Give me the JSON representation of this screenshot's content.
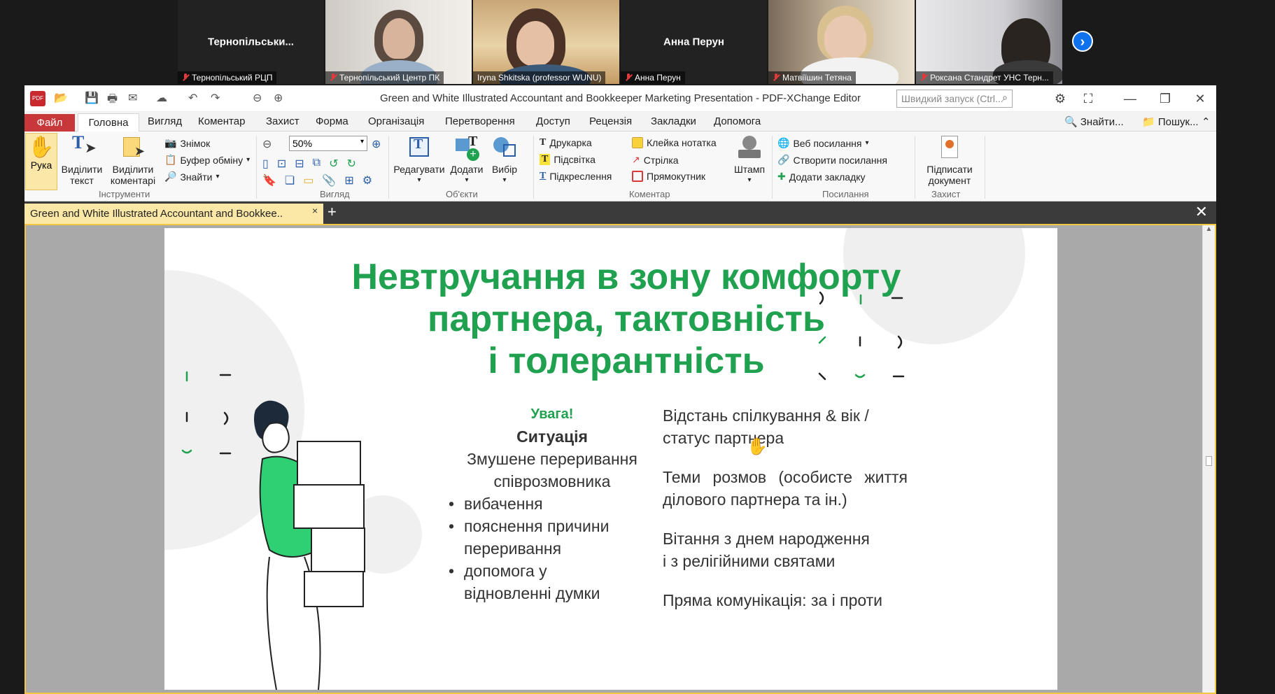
{
  "zoom_call": {
    "participants": [
      {
        "center_name": "Тернопільськи...",
        "label": "Тернопільський РЦП",
        "video": false
      },
      {
        "center_name": "",
        "label": "Тернопільський Центр ПК",
        "video": true
      },
      {
        "center_name": "",
        "label": "Iryna Shkitska (professor WUNU)",
        "video": true,
        "active": true
      },
      {
        "center_name": "Анна Перун",
        "label": "Анна Перун",
        "video": false
      },
      {
        "center_name": "",
        "label": "Матвіїшин Тетяна",
        "video": true
      },
      {
        "center_name": "",
        "label": "Роксана Стандрет УНС Терн...",
        "video": true
      }
    ],
    "next_icon": "chevron-right-icon"
  },
  "window": {
    "title": "Green and White Illustrated Accountant and Bookkeeper Marketing Presentation - PDF-XChange Editor",
    "quick_search_placeholder": "Швидкий запуск (Ctrl...",
    "app_icon_text": "PDF"
  },
  "menu": {
    "file": "Файл",
    "items": [
      "Головна",
      "Вигляд",
      "Коментар",
      "Захист",
      "Форма",
      "Організація",
      "Перетворення",
      "Доступ",
      "Рецензія",
      "Закладки",
      "Допомога"
    ],
    "find": "Знайти...",
    "search": "Пошук..."
  },
  "ribbon": {
    "tools": {
      "label": "Інструменти",
      "hand": "Рука",
      "select_text_1": "Виділити",
      "select_text_2": "текст",
      "select_comments_1": "Виділити",
      "select_comments_2": "коментарі",
      "snapshot": "Знімок",
      "clipboard": "Буфер обміну",
      "find": "Знайти"
    },
    "view": {
      "label": "Вигляд",
      "zoom": "50%"
    },
    "objects": {
      "label": "Об'єкти",
      "edit": "Редагувати",
      "add": "Додати",
      "select": "Вибір"
    },
    "comment": {
      "label": "Коментар",
      "typewriter": "Друкарка",
      "highlight": "Підсвітка",
      "underline": "Підкреслення",
      "sticky_note": "Клейка нотатка",
      "arrow": "Стрілка",
      "rectangle": "Прямокутник",
      "stamp": "Штамп"
    },
    "links": {
      "label": "Посилання",
      "web_links": "Веб посилання",
      "create_link": "Створити посилання",
      "add_bookmark": "Додати закладку"
    },
    "protect": {
      "label": "Захист",
      "sign_1": "Підписати",
      "sign_2": "документ"
    }
  },
  "tab": {
    "title": "Green and White Illustrated Accountant and Bookkee..",
    "close": "×",
    "add": "+",
    "close_all": "✕"
  },
  "slide": {
    "title_1": "Невтручання в зону комфорту",
    "title_2": "партнера, тактовність",
    "title_3": "і толерантність",
    "attention": "Увага!",
    "situation": "Ситуація",
    "situation_desc_1": "Змушене переривання",
    "situation_desc_2": "співрозмовника",
    "bullets": [
      "вибачення",
      "пояснення причини переривання",
      "допомога у відновленні  думки"
    ],
    "right_1": "Відстань спілкування & вік / статус партнера",
    "right_2": "Теми   розмов   (особисте   життя ділового партнера та ін.)",
    "right_3a": "Вітання з днем народження",
    "right_3b": " і з релігійними святами",
    "right_4": "Пряма комунікація: за і проти"
  },
  "colors": {
    "accent_green": "#1fa14f",
    "file_menu_red": "#c8373a",
    "tab_yellow": "#fbe7a6",
    "zoom_blue": "#0e72ed"
  }
}
